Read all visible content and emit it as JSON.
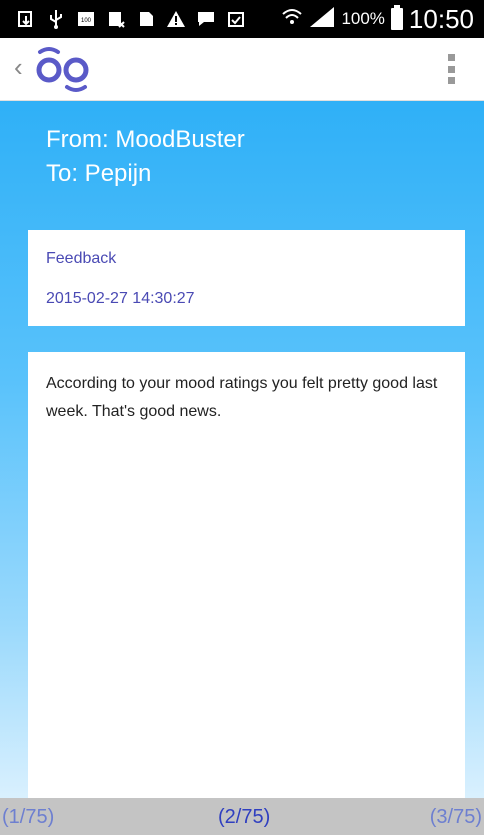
{
  "status_bar": {
    "icons": [
      "download-icon",
      "usb-icon",
      "battery-100-icon",
      "sim-icon",
      "sd-card-icon",
      "warning-icon",
      "chat-icon",
      "clipboard-check-icon"
    ],
    "battery_percent": "100%",
    "time": "10:50"
  },
  "app_bar": {
    "back_glyph": "‹",
    "logo": "oo-logo"
  },
  "message": {
    "from": "From: MoodBuster",
    "to": "To: Pepijn",
    "subject": "Feedback",
    "date": "2015-02-27 14:30:27",
    "body": "According to your mood ratings you felt pretty good last week. That's good news."
  },
  "pager": {
    "prev": "(1/75)",
    "current": "(2/75)",
    "next": "(3/75)"
  },
  "colors": {
    "accent": "#2fb0f7",
    "link": "#4a4ab4",
    "logo": "#5a5ac8"
  }
}
